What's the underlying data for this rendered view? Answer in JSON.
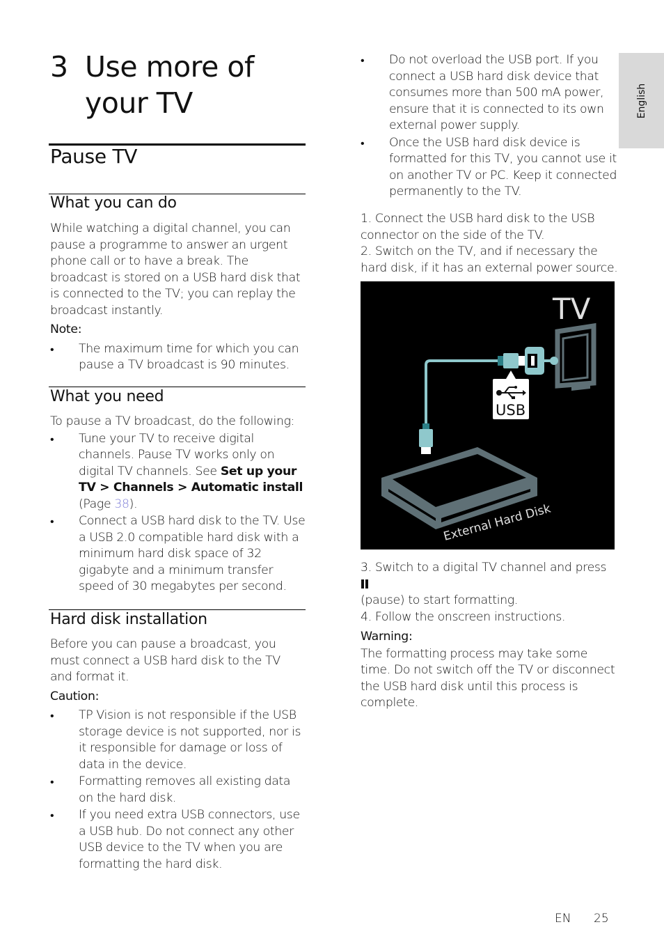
{
  "chapter": {
    "number": "3",
    "title": "Use more of your TV"
  },
  "section_title": "Pause TV",
  "side_tab": "English",
  "what_you_can_do": {
    "heading": "What you can do",
    "body": "While watching a digital channel, you can pause a programme to answer an urgent phone call or to have a break. The broadcast is stored on a USB hard disk that is connected to the TV; you can replay the broadcast instantly.",
    "note_label": "Note:",
    "notes": [
      "The maximum time for which you can pause a TV broadcast is 90 minutes."
    ]
  },
  "what_you_need": {
    "heading": "What you need",
    "intro": "To pause a TV broadcast, do the following:",
    "item1_text": "Tune your TV to receive digital channels. Pause TV works only on digital TV channels. See ",
    "item1_bold": "Set up your TV > Channels > Automatic install",
    "item1_page_prefix": " (Page ",
    "item1_page": "38",
    "item1_suffix": ").",
    "item2": "Connect a USB hard disk to the TV. Use a USB 2.0 compatible hard disk with a minimum hard disk space of 32 gigabyte and a minimum transfer speed of 30 megabytes per second."
  },
  "hard_disk_installation": {
    "heading": "Hard disk installation",
    "body": "Before you can pause a broadcast, you must connect a USB hard disk to the TV and format it.",
    "caution_label": "Caution:",
    "cautions": [
      "TP Vision is not responsible if the USB storage device is not supported, nor is it responsible for damage or loss of data in the device.",
      "Formatting removes all existing data on the hard disk.",
      "If you need extra USB connectors, use a USB hub. Do not connect any other USB device to the TV when you are formatting the hard disk."
    ]
  },
  "right_column": {
    "bullets": [
      "Do not overload the USB port. If you connect a USB hard disk device that consumes more than 500 mA power, ensure that it is connected to its own external power supply.",
      "Once the USB hard disk device is formatted for this TV, you cannot use it on another TV or PC. Keep it connected permanently to the TV."
    ],
    "step1": "1. Connect the USB hard disk to the USB connector on the side of the TV.",
    "step2": "2. Switch on the TV, and if necessary the hard disk, if it has an external power source.",
    "step3_a": "3. Switch to a digital TV channel and press ",
    "step3_b": "(pause) to start formatting.",
    "step4": "4. Follow the onscreen instructions.",
    "warning_label": "Warning:",
    "warning_text": "The formatting process may take some time. Do not switch off the TV or disconnect the USB hard disk until this process is complete."
  },
  "figure": {
    "tv_label": "TV",
    "usb_label": "USB",
    "disk_label": "External Hard Disk",
    "colors": {
      "background": "#000000",
      "cable": "#8fc8cc",
      "device": "#5f7076",
      "label_text": "#e0e0e0"
    }
  },
  "footer": {
    "lang": "EN",
    "page": "25"
  }
}
